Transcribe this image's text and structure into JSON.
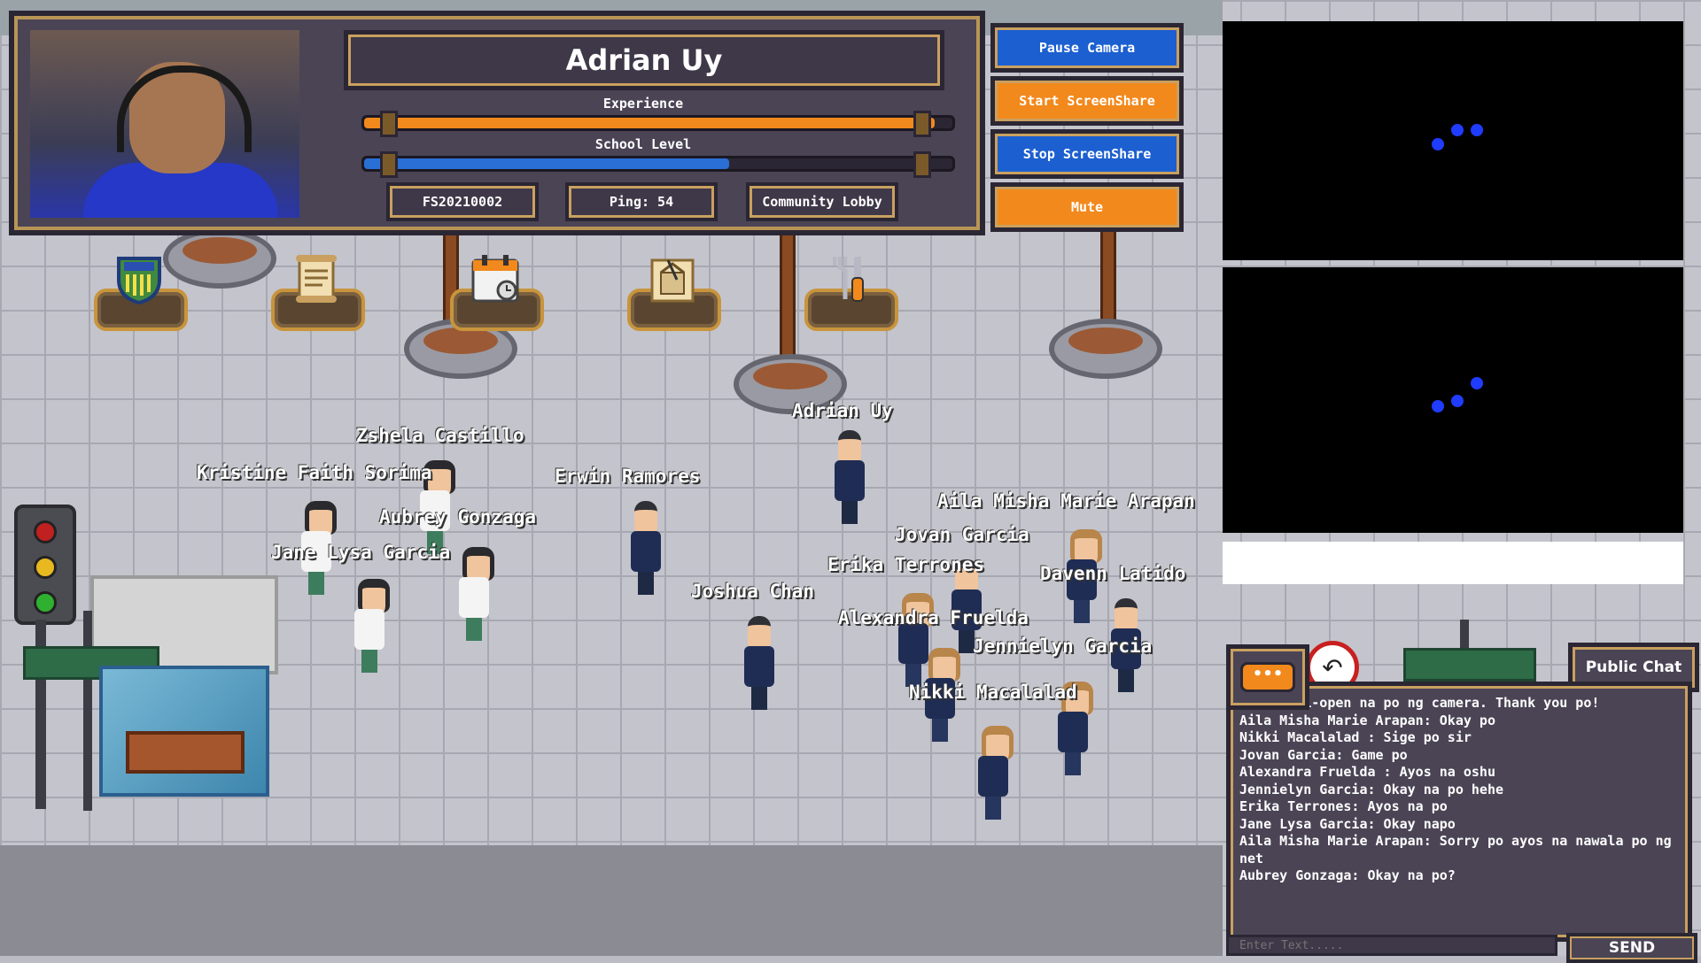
{
  "player": {
    "name": "Adrian Uy",
    "experience_label": "Experience",
    "school_level_label": "School Level",
    "experience_progress": 0.97,
    "school_level_progress": 0.62,
    "id": "FS20210002",
    "ping": "Ping: 54",
    "room": "Community Lobby"
  },
  "controls": {
    "pause_camera": "Pause Camera",
    "start_screenshare": "Start ScreenShare",
    "stop_screenshare": "Stop ScreenShare",
    "mute": "Mute"
  },
  "toolbar_icons": [
    "crest-icon",
    "scroll-icon",
    "calendar-icon",
    "blueprint-icon",
    "tools-icon"
  ],
  "characters": [
    {
      "name": "Zshela Castillo"
    },
    {
      "name": "Kristine Faith Sorima"
    },
    {
      "name": "Erwin Ramores"
    },
    {
      "name": "Aubrey Gonzaga"
    },
    {
      "name": "Jane Lysa Garcia"
    },
    {
      "name": "Adrian Uy"
    },
    {
      "name": "Aila Misha Marie Arapan"
    },
    {
      "name": "Jovan Garcia"
    },
    {
      "name": "Erika Terrones"
    },
    {
      "name": "Davenn Latido"
    },
    {
      "name": "Joshua Chan"
    },
    {
      "name": "Alexandra Fruelda"
    },
    {
      "name": "Jennielyn Garcia"
    },
    {
      "name": "Nikki Macalalad"
    }
  ],
  "chat": {
    "tab_label": "Public Chat",
    "messages": [
      "han: Paki-open na po ng camera. Thank you po!",
      "Aila Misha Marie Arapan: Okay po",
      "Nikki Macalalad : Sige po sir",
      "Jovan Garcia: Game po",
      "Alexandra Fruelda : Ayos na oshu",
      "Jennielyn Garcia: Okay na po hehe",
      "Erika Terrones: Ayos na po",
      "Jane Lysa Garcia: Okay napo",
      "Aila Misha Marie Arapan: Sorry po ayos na nawala po ng net",
      "Aubrey Gonzaga: Okay na po?"
    ],
    "input_placeholder": "Enter Text.....",
    "send_label": "SEND"
  },
  "colors": {
    "blue_button": "#1c5fd0",
    "orange_button": "#f2891c",
    "panel": "#4a4455",
    "gold_trim": "#c9a060"
  }
}
